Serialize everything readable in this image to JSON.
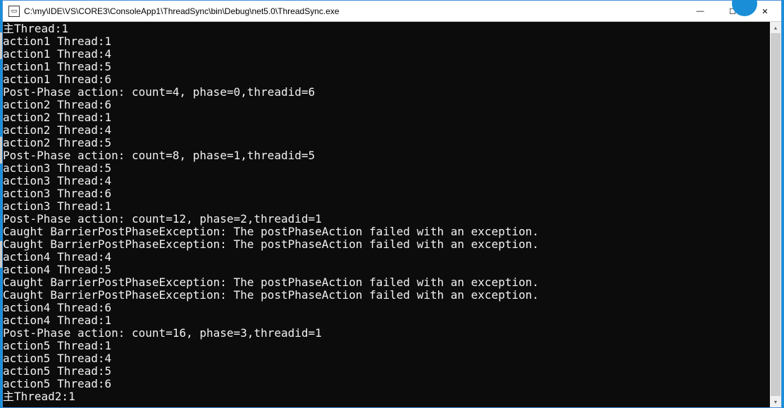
{
  "window": {
    "icon_glyph": "▭",
    "title": "C:\\my\\IDE\\VS\\CORE3\\ConsoleApp1\\ThreadSync\\bin\\Debug\\net5.0\\ThreadSync.exe",
    "minimize_glyph": "—",
    "maximize_glyph": "☐",
    "close_glyph": "✕"
  },
  "scrollbar": {
    "up_glyph": "▴",
    "down_glyph": "▾"
  },
  "console_lines": [
    "主Thread:1",
    "action1 Thread:1",
    "action1 Thread:4",
    "action1 Thread:5",
    "action1 Thread:6",
    "Post-Phase action: count=4, phase=0,threadid=6",
    "action2 Thread:6",
    "action2 Thread:1",
    "action2 Thread:4",
    "action2 Thread:5",
    "Post-Phase action: count=8, phase=1,threadid=5",
    "action3 Thread:5",
    "action3 Thread:4",
    "action3 Thread:6",
    "action3 Thread:1",
    "Post-Phase action: count=12, phase=2,threadid=1",
    "Caught BarrierPostPhaseException: The postPhaseAction failed with an exception.",
    "Caught BarrierPostPhaseException: The postPhaseAction failed with an exception.",
    "action4 Thread:4",
    "action4 Thread:5",
    "Caught BarrierPostPhaseException: The postPhaseAction failed with an exception.",
    "Caught BarrierPostPhaseException: The postPhaseAction failed with an exception.",
    "action4 Thread:6",
    "action4 Thread:1",
    "Post-Phase action: count=16, phase=3,threadid=1",
    "action5 Thread:1",
    "action5 Thread:4",
    "action5 Thread:5",
    "action5 Thread:6",
    "主Thread2:1"
  ]
}
